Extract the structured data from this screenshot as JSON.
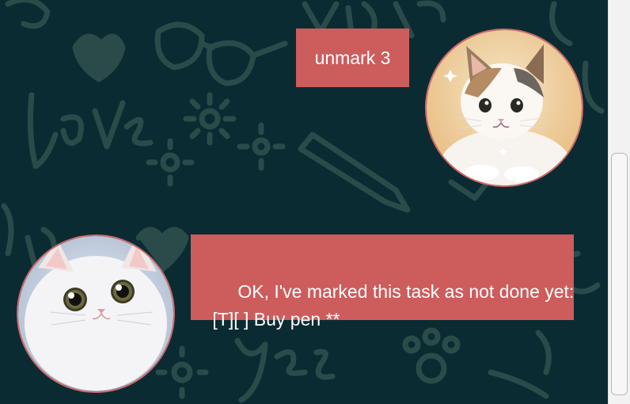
{
  "colors": {
    "background": "#0b2b33",
    "bubble": "#cd5c5c",
    "bubble_text": "#ffffff",
    "avatar_border": "#d06a6a"
  },
  "messages": [
    {
      "sender": "user",
      "text": "unmark 3",
      "avatar": "cat-avatar-tabby"
    },
    {
      "sender": "bot",
      "text": "OK, I've marked this task as not done yet:\n [T][ ] Buy pen **",
      "avatar": "cat-avatar-white"
    }
  ],
  "scrollbar": {
    "position": 0.62
  }
}
